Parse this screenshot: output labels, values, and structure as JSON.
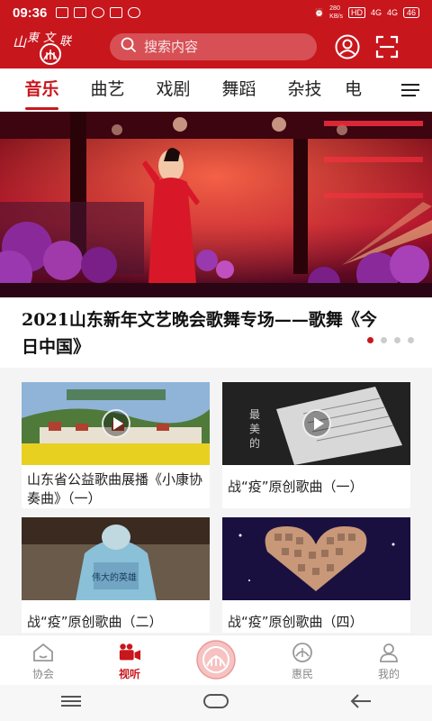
{
  "status_bar": {
    "time": "09:36",
    "net_speed": "280\nKB/s",
    "hd": "HD",
    "sig1": "4G",
    "sig2": "4G",
    "battery": "46"
  },
  "search": {
    "placeholder": "搜索内容"
  },
  "tabs": [
    "音乐",
    "曲艺",
    "戏剧",
    "舞蹈",
    "杂技",
    "电"
  ],
  "banner": {
    "title": "2021山东新年文艺晚会歌舞专场——歌舞《今日中国》",
    "active_dot": 0,
    "dot_count": 4
  },
  "cards": [
    {
      "label": "山东省公益歌曲展播《小康协奏曲》（一）",
      "thumb": "village"
    },
    {
      "label": "战“疫”原创歌曲（一）",
      "thumb": "sheet"
    },
    {
      "label": "战“疫”原创歌曲（二）",
      "thumb": "medic"
    },
    {
      "label": "战“疫”原创歌曲（四）",
      "thumb": "heart"
    }
  ],
  "bottom_nav": [
    {
      "label": "协会",
      "icon": "home-icon"
    },
    {
      "label": "视听",
      "icon": "video-camera-icon",
      "active": true
    },
    {
      "label": "",
      "icon": "center-logo-icon"
    },
    {
      "label": "惠民",
      "icon": "benefit-icon"
    },
    {
      "label": "我的",
      "icon": "profile-icon"
    }
  ],
  "colors": {
    "brand": "#c8161d"
  }
}
